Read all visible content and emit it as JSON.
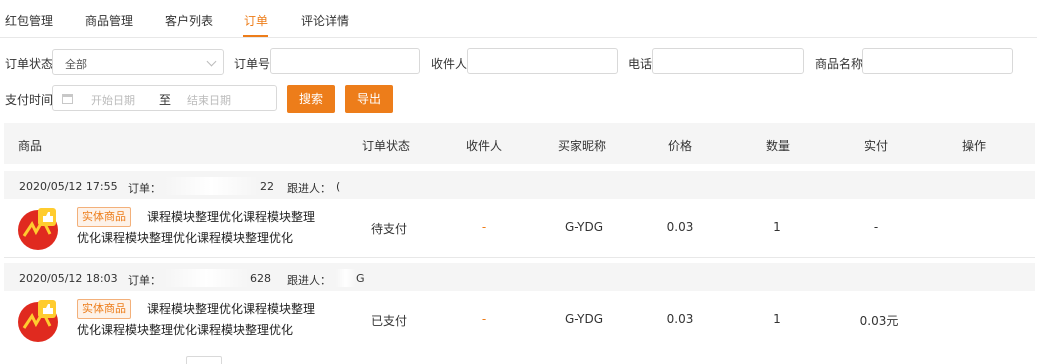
{
  "tabs": [
    {
      "label": "红包管理",
      "active": false
    },
    {
      "label": "商品管理",
      "active": false
    },
    {
      "label": "客户列表",
      "active": false
    },
    {
      "label": "订单",
      "active": true
    },
    {
      "label": "评论详情",
      "active": false
    }
  ],
  "filters": {
    "order_status_label": "订单状态",
    "order_status_value": "全部",
    "order_no_label": "订单号",
    "receiver_label": "收件人",
    "phone_label": "电话",
    "product_name_label": "商品名称",
    "pay_time_label": "支付时间",
    "start_placeholder": "开始日期",
    "range_sep": "至",
    "end_placeholder": "结束日期",
    "search_button": "搜索",
    "export_button": "导出"
  },
  "table": {
    "columns": [
      "商品",
      "订单状态",
      "收件人",
      "买家昵称",
      "价格",
      "数量",
      "实付",
      "操作"
    ],
    "orders": [
      {
        "time": "2020/05/12 17:55",
        "order_label": "订单：",
        "order_no_tail": "22",
        "follower_label": "跟进人：",
        "follower_tail": "(",
        "tag": "实体商品",
        "title": "课程模块整理优化课程模块整理优化课程模块整理优化课程模块整理优化",
        "status": "待支付",
        "receiver": "-",
        "buyer": "G-YDG",
        "price": "0.03",
        "qty": "1",
        "paid": "-"
      },
      {
        "time": "2020/05/12 18:03",
        "order_label": "订单：",
        "order_no_tail": "628",
        "follower_label": "跟进人：",
        "follower_tail": "G",
        "tag": "实体商品",
        "title": "课程模块整理优化课程模块整理优化课程模块整理优化课程模块整理优化",
        "status": "已支付",
        "receiver": "-",
        "buyer": "G-YDG",
        "price": "0.03",
        "qty": "1",
        "paid": "0.03元"
      }
    ]
  },
  "colors": {
    "accent": "#ed7d1a"
  },
  "icons": {
    "calendar": "calendar-icon",
    "dropdown": "chevron-down-icon",
    "product": "thumbs-up-badge-icon"
  }
}
